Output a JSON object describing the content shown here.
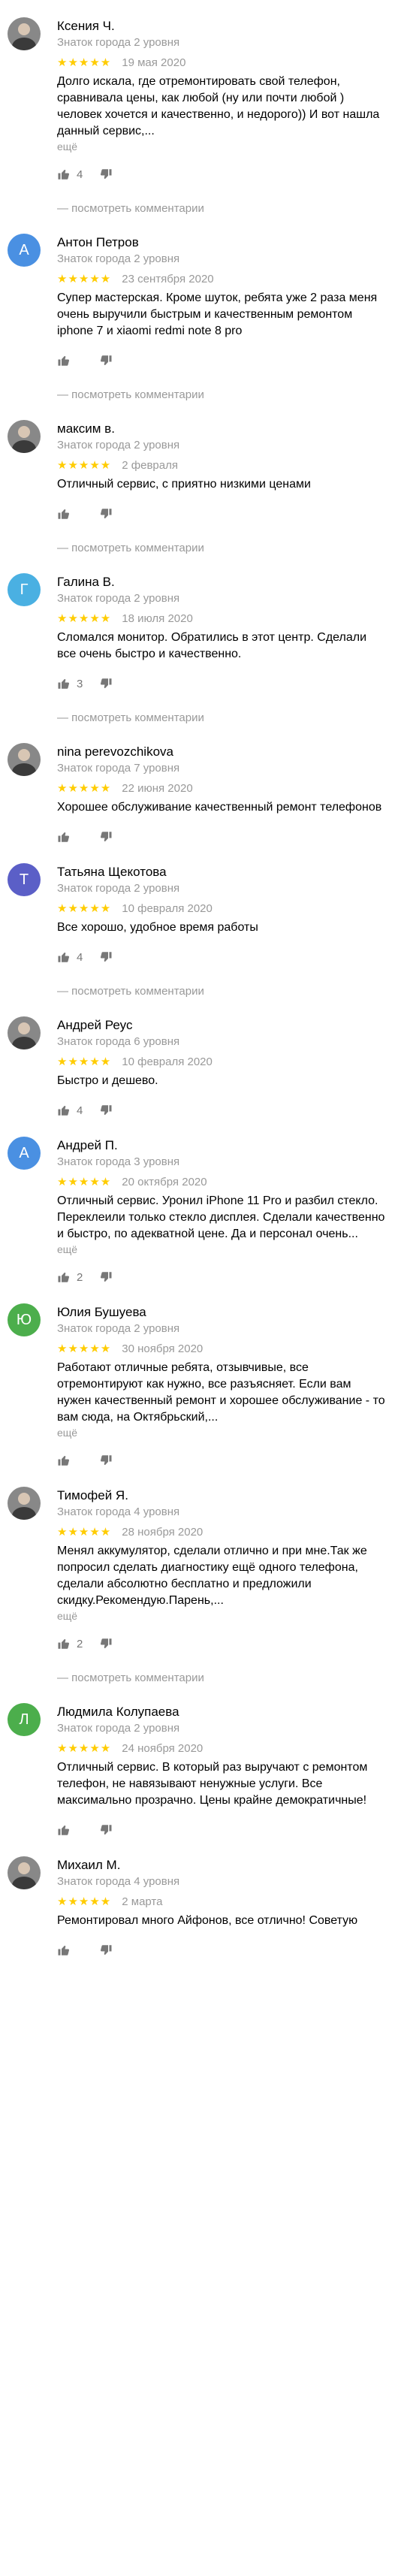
{
  "ui": {
    "more_label": "ещё",
    "comments_label": "— посмотреть комментарии",
    "star_color": "#ffcc00",
    "muted_color": "#999999"
  },
  "reviews": [
    {
      "name": "Ксения Ч.",
      "level": "Знаток города 2 уровня",
      "avatar": {
        "type": "photo"
      },
      "rating": 5,
      "date": "19 мая 2020",
      "text": "Долго искала, где отремонтировать свой телефон, сравнивала цены, как любой (ну или почти любой ) человек хочется и качественно, и недорого)) И вот нашла данный сервис,...",
      "more": true,
      "likes": "4",
      "comments": true
    },
    {
      "name": "Антон Петров",
      "level": "Знаток города 2 уровня",
      "avatar": {
        "type": "letter",
        "letter": "А",
        "color": "#4a90e2"
      },
      "rating": 5,
      "date": "23 сентября 2020",
      "text": "Супер мастерская. Кроме шуток, ребята уже 2 раза меня очень выручили быстрым и качественным ремонтом iphone 7 и xiaomi redmi note 8 pro",
      "more": false,
      "likes": "",
      "comments": true
    },
    {
      "name": "максим в.",
      "level": "Знаток города 2 уровня",
      "avatar": {
        "type": "photo"
      },
      "rating": 5,
      "date": "2 февраля",
      "text": "Отличный сервис, с приятно низкими ценами",
      "more": false,
      "likes": "",
      "comments": true
    },
    {
      "name": "Галина В.",
      "level": "Знаток города 2 уровня",
      "avatar": {
        "type": "letter",
        "letter": "Г",
        "color": "#4ab0e2"
      },
      "rating": 5,
      "date": "18 июля 2020",
      "text": "Сломался монитор. Обратились в этот центр. Сделали все очень быстро и качественно.",
      "more": false,
      "likes": "3",
      "comments": true
    },
    {
      "name": "nina perevozchikova",
      "level": "Знаток города 7 уровня",
      "avatar": {
        "type": "photo"
      },
      "rating": 5,
      "date": "22 июня 2020",
      "text": "Хорошее обслуживание качественный ремонт телефонов",
      "more": false,
      "likes": "",
      "comments": false
    },
    {
      "name": "Татьяна Щекотова",
      "level": "Знаток города 2 уровня",
      "avatar": {
        "type": "letter",
        "letter": "Т",
        "color": "#5b5fc7"
      },
      "rating": 5,
      "date": "10 февраля 2020",
      "text": "Все хорошо, удобное время работы",
      "more": false,
      "likes": "4",
      "comments": true
    },
    {
      "name": "Андрей Реус",
      "level": "Знаток города 6 уровня",
      "avatar": {
        "type": "photo"
      },
      "rating": 5,
      "date": "10 февраля 2020",
      "text": "Быстро и дешево.",
      "more": false,
      "likes": "4",
      "comments": false
    },
    {
      "name": "Андрей П.",
      "level": "Знаток города 3 уровня",
      "avatar": {
        "type": "letter",
        "letter": "А",
        "color": "#4a90e2"
      },
      "rating": 5,
      "date": "20 октября 2020",
      "text": "Отличный сервис. Уронил iPhone 11 Pro и разбил стекло. Переклеили только стекло дисплея. Сделали качественно и быстро, по адекватной цене. Да и персонал очень...",
      "more": true,
      "likes": "2",
      "comments": false
    },
    {
      "name": "Юлия Бушуева",
      "level": "Знаток города 2 уровня",
      "avatar": {
        "type": "letter",
        "letter": "Ю",
        "color": "#4cae4c"
      },
      "rating": 5,
      "date": "30 ноября 2020",
      "text": "Работают отличные ребята, отзывчивые, все отремонтируют как нужно, все разъясняет. Если вам нужен качественный ремонт и хорошее обслуживание - то вам сюда, на Октябрьский,...",
      "more": true,
      "likes": "",
      "comments": false
    },
    {
      "name": "Тимофей Я.",
      "level": "Знаток города 4 уровня",
      "avatar": {
        "type": "photo"
      },
      "rating": 5,
      "date": "28 ноября 2020",
      "text": "Менял аккумулятор, сделали отлично и при мне.Так же попросил сделать диагностику ещё одного телефона, сделали абсолютно бесплатно и предложили скидку.Рекомендую.Парень,...",
      "more": true,
      "likes": "2",
      "comments": true
    },
    {
      "name": "Людмила Колупаева",
      "level": "Знаток города 2 уровня",
      "avatar": {
        "type": "letter",
        "letter": "Л",
        "color": "#4cae4c"
      },
      "rating": 5,
      "date": "24 ноября 2020",
      "text": "Отличный сервис. В который раз выручают с ремонтом телефон, не навязывают ненужные услуги. Все максимально прозрачно. Цены крайне демократичные!",
      "more": false,
      "likes": "",
      "comments": false
    },
    {
      "name": "Михаил М.",
      "level": "Знаток города 4 уровня",
      "avatar": {
        "type": "photo"
      },
      "rating": 5,
      "date": "2 марта",
      "text": "Ремонтировал много Айфонов, все отлично! Советую",
      "more": false,
      "likes": "",
      "comments": false
    }
  ]
}
